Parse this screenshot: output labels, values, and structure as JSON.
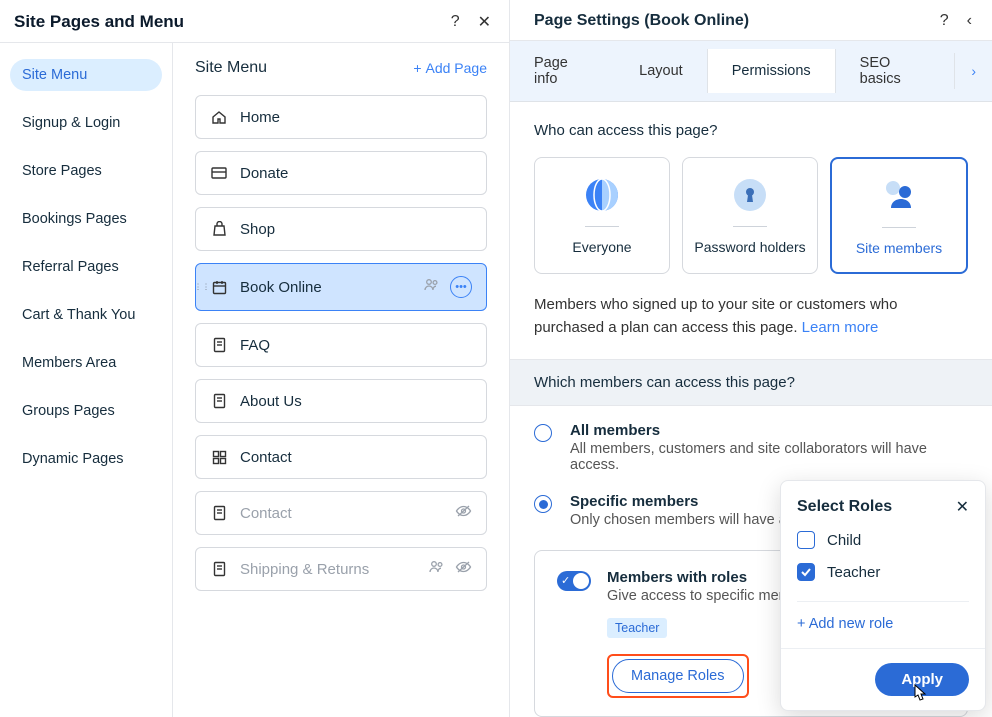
{
  "leftPanel": {
    "title": "Site Pages and Menu",
    "helpGlyph": "?",
    "closeGlyph": "✕",
    "sidebar": {
      "items": [
        {
          "label": "Site Menu",
          "active": true
        },
        {
          "label": "Signup & Login"
        },
        {
          "label": "Store Pages"
        },
        {
          "label": "Bookings Pages"
        },
        {
          "label": "Referral Pages"
        },
        {
          "label": "Cart & Thank You"
        },
        {
          "label": "Members Area"
        },
        {
          "label": "Groups Pages"
        },
        {
          "label": "Dynamic Pages"
        }
      ]
    },
    "pagesColumn": {
      "heading": "Site Menu",
      "addPage": "Add Page",
      "items": [
        {
          "label": "Home",
          "icon": "home"
        },
        {
          "label": "Donate",
          "icon": "card"
        },
        {
          "label": "Shop",
          "icon": "bag"
        },
        {
          "label": "Book Online",
          "icon": "calendar",
          "selected": true,
          "hasActions": true,
          "people": true
        },
        {
          "label": "FAQ",
          "icon": "doc"
        },
        {
          "label": "About Us",
          "icon": "doc"
        },
        {
          "label": "Contact",
          "icon": "grid"
        },
        {
          "label": "Contact",
          "icon": "doc",
          "dimmed": true,
          "hidden": true
        },
        {
          "label": "Shipping & Returns",
          "icon": "doc",
          "dimmed": true,
          "hidden": true,
          "people": true
        }
      ]
    }
  },
  "rightPanel": {
    "title": "Page Settings (Book Online)",
    "helpGlyph": "?",
    "backGlyph": "‹",
    "tabs": {
      "items": [
        {
          "label": "Page info"
        },
        {
          "label": "Layout"
        },
        {
          "label": "Permissions",
          "active": true
        },
        {
          "label": "SEO basics"
        }
      ],
      "moreGlyph": "›"
    },
    "whoAccessLabel": "Who can access this page?",
    "cards": [
      {
        "id": "everyone",
        "label": "Everyone",
        "icon": "globe"
      },
      {
        "id": "password",
        "label": "Password holders",
        "icon": "keyhole"
      },
      {
        "id": "members",
        "label": "Site members",
        "icon": "members",
        "selected": true
      }
    ],
    "membersDesc": "Members who signed up to your site or customers who purchased a plan can access this page. ",
    "learnMore": "Learn more",
    "whichMembersLabel": "Which members can access this page?",
    "radios": {
      "all": {
        "title": "All members",
        "desc": "All members, customers and site collaborators will have access."
      },
      "specific": {
        "title": "Specific members",
        "desc": "Only chosen members will have access.",
        "selected": true
      }
    },
    "rolesBox": {
      "title": "Members with roles",
      "desc": "Give access to specific member roles.",
      "chips": [
        "Teacher"
      ],
      "manageLabel": "Manage Roles"
    }
  },
  "popover": {
    "title": "Select Roles",
    "closeGlyph": "✕",
    "roles": [
      {
        "label": "Child",
        "checked": false
      },
      {
        "label": "Teacher",
        "checked": true
      }
    ],
    "addNew": "+ Add new role",
    "applyLabel": "Apply"
  }
}
